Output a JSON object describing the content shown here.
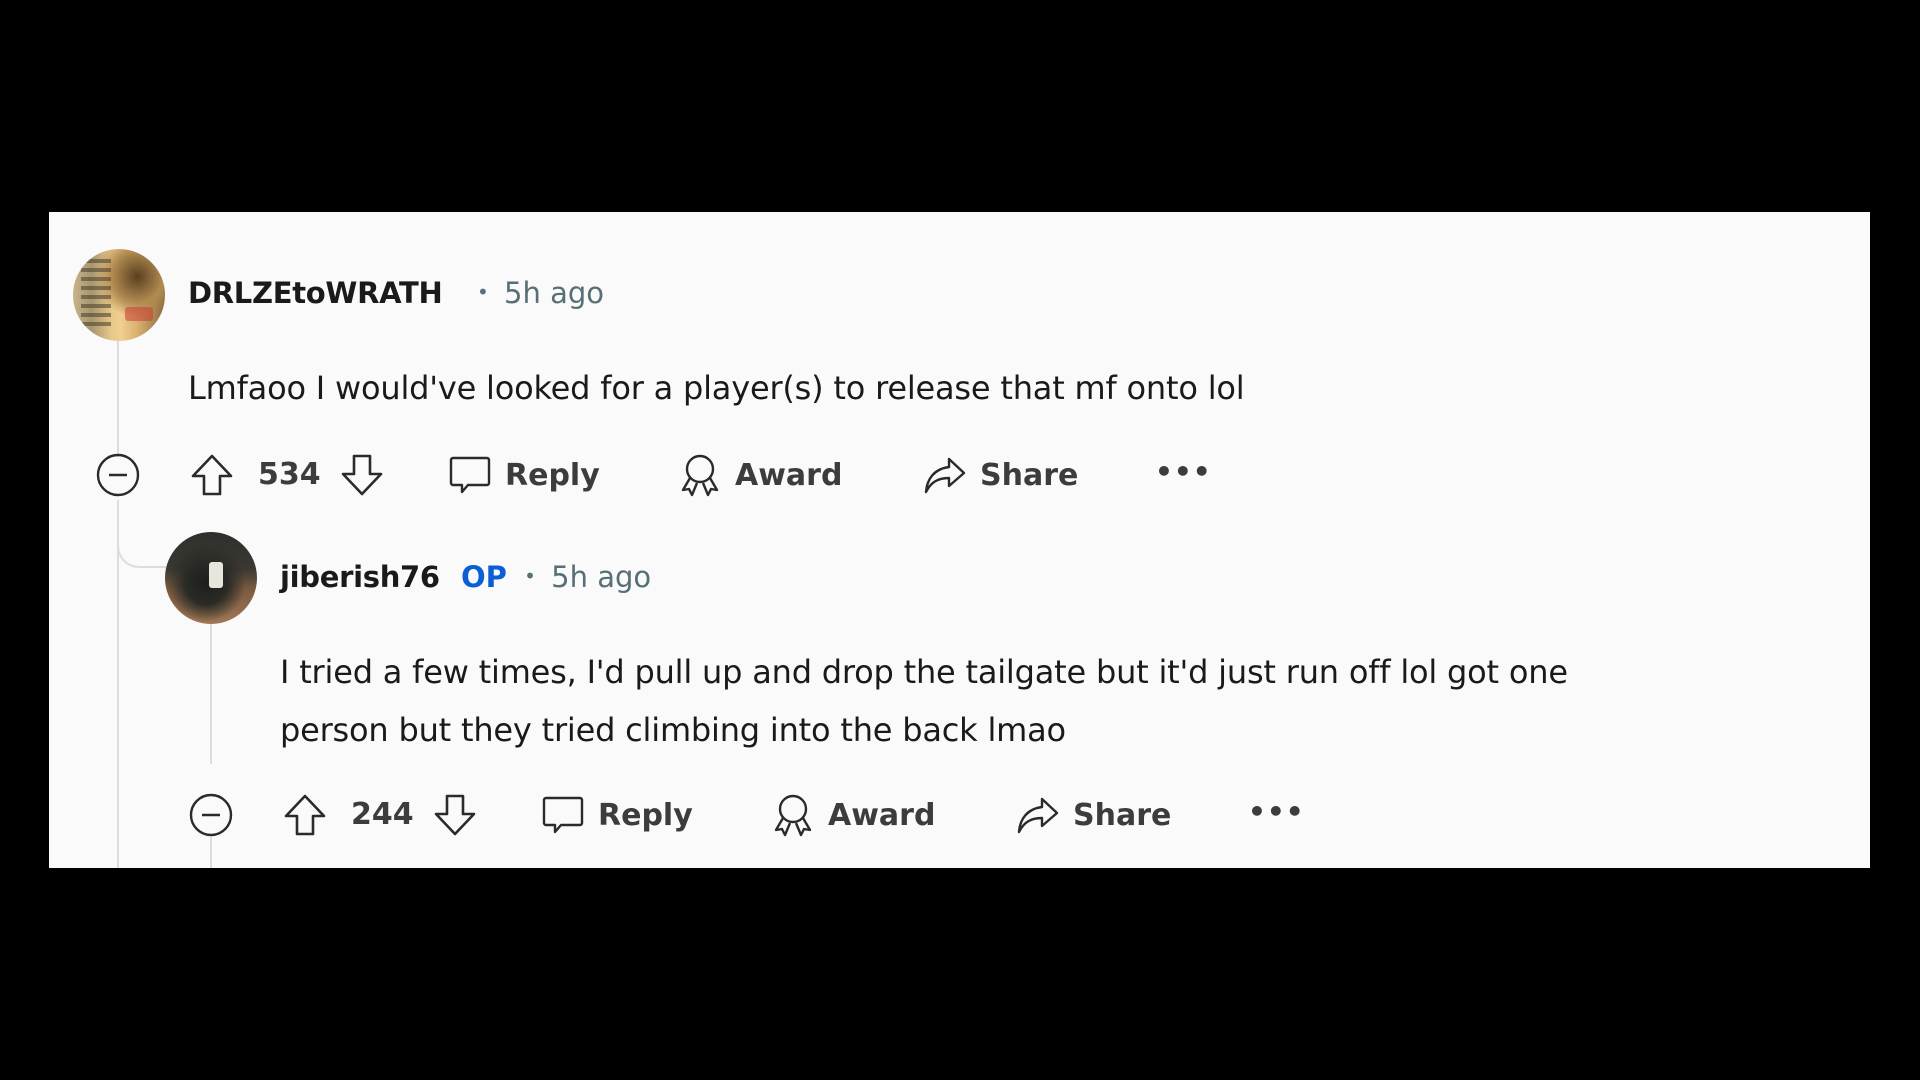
{
  "comments": [
    {
      "author": "DRLZEtoWRATH",
      "op_badge": "",
      "separator": "•",
      "time": "5h ago",
      "body": "Lmfaoo I would've looked for a player(s) to release that mf onto lol",
      "score": "534",
      "actions": {
        "reply": "Reply",
        "award": "Award",
        "share": "Share",
        "more": "•••"
      }
    },
    {
      "author": "jiberish76",
      "op_badge": "OP",
      "separator": "•",
      "time": "5h ago",
      "body_lines": [
        "I tried a few times, I'd pull up and drop the tailgate but it'd just run off lol got one",
        "person but they tried climbing into the back lmao"
      ],
      "score": "244",
      "actions": {
        "reply": "Reply",
        "award": "Award",
        "share": "Share",
        "more": "•••"
      }
    }
  ],
  "colors": {
    "op_badge": "#0a5fd6",
    "meta": "#576f76",
    "thread_line": "#dcdcdc",
    "card_bg": "#fafafa"
  }
}
